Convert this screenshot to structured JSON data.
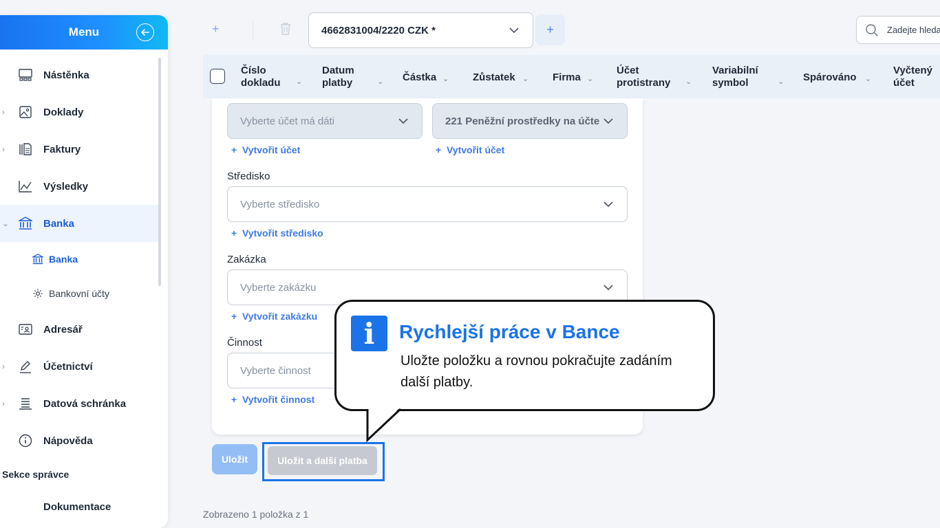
{
  "sidebar": {
    "title": "Menu",
    "items": [
      {
        "label": "Nástěnka"
      },
      {
        "label": "Doklady"
      },
      {
        "label": "Faktury"
      },
      {
        "label": "Výsledky"
      },
      {
        "label": "Banka"
      },
      {
        "label": "Banka"
      },
      {
        "label": "Bankovní účty"
      },
      {
        "label": "Adresář"
      },
      {
        "label": "Účetnictví"
      },
      {
        "label": "Datová schránka"
      },
      {
        "label": "Nápověda"
      }
    ],
    "section_title": "Sekce správce",
    "documentation_label": "Dokumentace"
  },
  "toolbar": {
    "account_selected": "4662831004/2220 CZK *",
    "search_placeholder": "Zadejte hledaný výraz"
  },
  "table": {
    "columns": [
      {
        "line1": "Číslo",
        "line2": "dokladu"
      },
      {
        "line1": "Datum",
        "line2": "platby"
      },
      {
        "line1": "Částka",
        "line2": ""
      },
      {
        "line1": "Zůstatek",
        "line2": ""
      },
      {
        "line1": "Firma",
        "line2": ""
      },
      {
        "line1": "Účet",
        "line2": "protistrany"
      },
      {
        "line1": "Variabilní",
        "line2": "symbol"
      },
      {
        "line1": "Spárováno",
        "line2": ""
      },
      {
        "line1": "Vyčtený",
        "line2": "účet"
      }
    ]
  },
  "form": {
    "account_debit_placeholder": "Vyberte účet má dáti",
    "account_credit_value": "221 Peněžní prostředky na účte",
    "create_account_link": "Vytvořit účet",
    "center_label": "Středisko",
    "center_placeholder": "Vyberte středisko",
    "create_center_link": "Vytvořit středisko",
    "order_label": "Zakázka",
    "order_placeholder": "Vyberte zakázku",
    "create_order_link": "Vytvořit zakázku",
    "activity_label": "Činnost",
    "activity_placeholder": "Vyberte činnost",
    "create_activity_link": "Vytvořit činnost"
  },
  "buttons": {
    "save": "Uložit",
    "save_next": "Uložit a další platba"
  },
  "footer": {
    "count_text": "Zobrazeno 1 položka z 1"
  },
  "callout": {
    "icon_letter": "i",
    "title": "Rychlejší práce v Bance",
    "body": "Uložte položku a rovnou pokračujte zadáním další platby."
  },
  "colors": {
    "accent": "#1a73e8",
    "menu_gradient_start": "#1a73f0",
    "menu_gradient_end": "#10b9f2",
    "table_header_bg": "#eaf0f8",
    "active_nav_bg": "#eef4fd"
  }
}
